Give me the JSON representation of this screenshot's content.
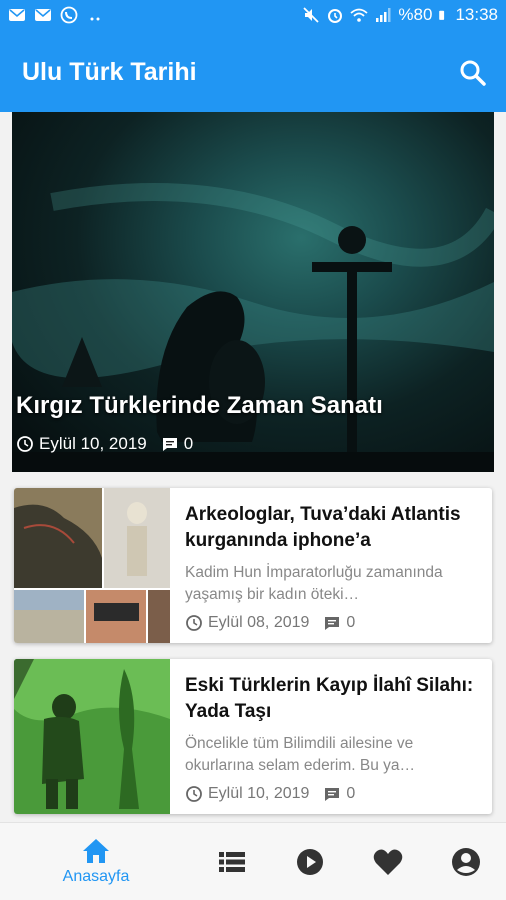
{
  "status_bar": {
    "battery": "%80",
    "time": "13:38",
    "icons": [
      "mail-icon",
      "mail-icon",
      "whatsapp-icon",
      "mute-icon",
      "alarm-icon",
      "wifi-icon",
      "signal-icon",
      "battery-icon"
    ]
  },
  "app_bar": {
    "title": "Ulu Türk Tarihi",
    "search_icon": "search-icon"
  },
  "featured": {
    "title": "Kırgız Türklerinde Zaman Sanatı",
    "date": "Eylül 10, 2019",
    "comments": "0"
  },
  "posts": [
    {
      "title": "Arkeologlar, Tuva’daki Atlantis kurganında iphone’a",
      "excerpt": "Kadim Hun İmparatorluğu zamanında yaşamış bir kadın öteki…",
      "date": "Eylül 08, 2019",
      "comments": "0"
    },
    {
      "title": "Eski Türklerin Kayıp İlahî Silahı: Yada Taşı",
      "excerpt": "Öncelikle tüm Bilimdili ailesine ve okurlarına selam ederim. Bu ya…",
      "date": "Eylül 10, 2019",
      "comments": "0"
    }
  ],
  "bottom_nav": {
    "home_label": "Anasayfa",
    "active_color": "#2196F3",
    "inactive_color": "#333333",
    "items": [
      "home-icon",
      "list-icon",
      "play-icon",
      "heart-icon",
      "account-icon"
    ]
  },
  "colors": {
    "primary": "#2196F3"
  }
}
